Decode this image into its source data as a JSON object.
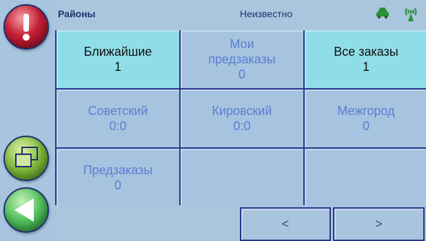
{
  "header": {
    "title": "Районы",
    "status": "Неизвестно",
    "taxi_icon": "taxi-car-icon",
    "signal_icon": "signal-antenna-icon"
  },
  "sidebar": {
    "alert_icon": "exclamation-icon",
    "windows_icon": "windows-stack-icon",
    "back_icon": "back-arrow-icon"
  },
  "cells": [
    {
      "label": "Ближайшие",
      "value": "1",
      "active": true
    },
    {
      "label": "Мои\nпредзаказы",
      "value": "0",
      "active": false
    },
    {
      "label": "Все заказы",
      "value": "1",
      "active": true
    },
    {
      "label": "Советский",
      "value": "0:0",
      "active": false
    },
    {
      "label": "Кировский",
      "value": "0:0",
      "active": false
    },
    {
      "label": "Межгород",
      "value": "0",
      "active": false
    },
    {
      "label": "Предзаказы",
      "value": "0",
      "active": false
    },
    {
      "label": "",
      "value": "",
      "active": false
    },
    {
      "label": "",
      "value": "",
      "active": false
    }
  ],
  "footer": {
    "prev_label": "<",
    "next_label": ">"
  },
  "colors": {
    "background": "#aac6df",
    "active_cell": "#8fdde8",
    "grid_lines": "#28338c",
    "inactive_text": "#5b7ed1"
  }
}
